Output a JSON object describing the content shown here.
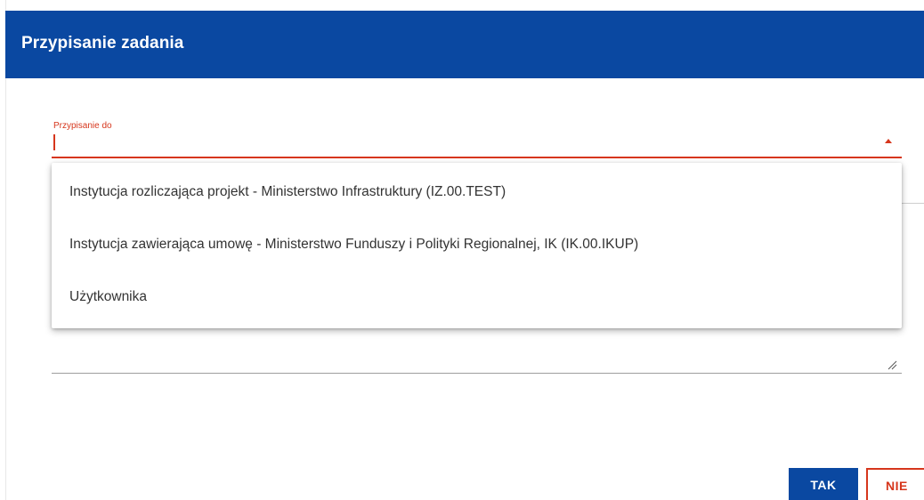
{
  "dialog": {
    "title": "Przypisanie zadania"
  },
  "assign_field": {
    "label": "Przypisanie do",
    "value": ""
  },
  "dropdown": {
    "options": [
      "Instytucja rozliczająca projekt - Ministerstwo Infrastruktury (IZ.00.TEST)",
      "Instytucja zawierająca umowę - Ministerstwo Funduszy i Polityki Regionalnej, IK (IK.00.IKUP)",
      "Użytkownika"
    ]
  },
  "buttons": {
    "confirm_label": "TAK",
    "cancel_label": "NIE"
  },
  "colors": {
    "header_bg": "#0a48a1",
    "accent_error": "#d6361c",
    "option_text": "#333333"
  },
  "icons": {
    "dropdown_arrow": "chevron-up-icon",
    "textarea_resize": "resize-handle-icon"
  }
}
